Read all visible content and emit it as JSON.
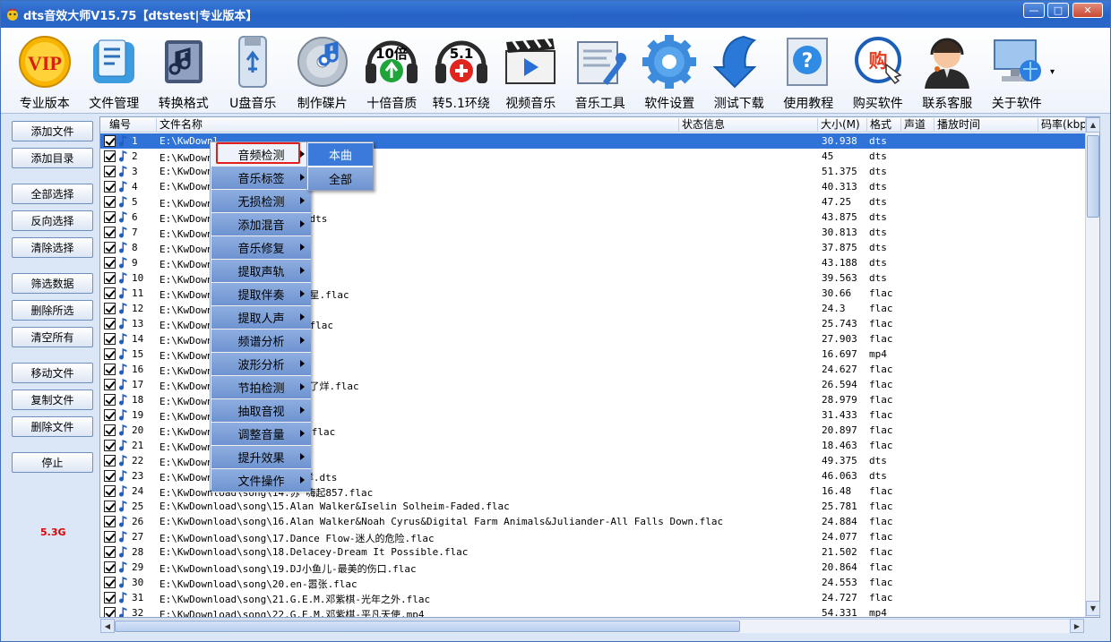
{
  "window": {
    "title": "dts音效大师V15.75【dtstest|专业版本】",
    "controls": {
      "minimize": "—",
      "maximize": "□",
      "close": "✕"
    }
  },
  "toolbar": {
    "items": [
      {
        "label": "专业版本",
        "icon": "vip-icon"
      },
      {
        "label": "文件管理",
        "icon": "file-manage-icon"
      },
      {
        "label": "转换格式",
        "icon": "convert-format-icon"
      },
      {
        "label": "U盘音乐",
        "icon": "usb-music-icon"
      },
      {
        "label": "制作碟片",
        "icon": "disc-icon"
      },
      {
        "label": "十倍音质",
        "icon": "ten-times-quality-icon",
        "badge": "10倍"
      },
      {
        "label": "转5.1环绕",
        "icon": "surround-icon",
        "badge": "5.1"
      },
      {
        "label": "视频音乐",
        "icon": "video-music-icon"
      },
      {
        "label": "音乐工具",
        "icon": "music-tools-icon"
      },
      {
        "label": "软件设置",
        "icon": "settings-gear-icon"
      },
      {
        "label": "测试下载",
        "icon": "download-arrow-icon"
      },
      {
        "label": "使用教程",
        "icon": "help-icon"
      },
      {
        "label": "购买软件",
        "icon": "buy-icon",
        "badge": "购"
      },
      {
        "label": "联系客服",
        "icon": "customer-service-icon"
      },
      {
        "label": "关于软件",
        "icon": "about-computer-icon"
      }
    ],
    "more": "▾"
  },
  "side": {
    "buttons": [
      "添加文件",
      "添加目录",
      "全部选择",
      "反向选择",
      "清除选择",
      "筛选数据",
      "删除所选",
      "清空所有",
      "移动文件",
      "复制文件",
      "删除文件",
      "停止"
    ],
    "disk_size": "5.3G"
  },
  "table": {
    "columns": [
      "编号",
      "文件名称",
      "状态信息",
      "大小(M)",
      "格式",
      "声道",
      "播放时间",
      "码率(kbps"
    ],
    "rows": [
      {
        "n": "1",
        "name": "E:\\KwDownl",
        "size": "30.938",
        "fmt": "dts"
      },
      {
        "n": "2",
        "name": "E:\\KwDownl                        天堂的魔鬼.dts",
        "size": "45",
        "fmt": "dts"
      },
      {
        "n": "3",
        "name": "E:\\KwDownl                        s",
        "size": "51.375",
        "fmt": "dts"
      },
      {
        "n": "4",
        "name": "E:\\KwDownl",
        "size": "40.313",
        "fmt": "dts"
      },
      {
        "n": "5",
        "name": "E:\\KwDownl                        一你若三冬.dts",
        "size": "47.25",
        "fmt": "dts"
      },
      {
        "n": "6",
        "name": "E:\\KwDownl                        一生与你擦肩而过.dts",
        "size": "43.875",
        "fmt": "dts"
      },
      {
        "n": "7",
        "name": "E:\\KwDownl                        一曲相思.dts",
        "size": "30.813",
        "fmt": "dts"
      },
      {
        "n": "8",
        "name": "E:\\KwDownl                        一红色高跟鞋.dts",
        "size": "37.875",
        "fmt": "dts"
      },
      {
        "n": "9",
        "name": "E:\\KwDownl                        一追光者.dts",
        "size": "43.188",
        "fmt": "dts"
      },
      {
        "n": "10",
        "name": "E:\\KwDownl                        一生僻字.dts",
        "size": "39.563",
        "fmt": "dts"
      },
      {
        "n": "11",
        "name": "E:\\KwDownl                        计划-夜空中最亮的星.flac",
        "size": "30.66",
        "fmt": "flac"
      },
      {
        "n": "12",
        "name": "E:\\KwDownl                        你的答案.flac",
        "size": "24.3",
        "fmt": "flac"
      },
      {
        "n": "13",
        "name": "E:\\KwDownl                        一生与你擦肩而过.flac",
        "size": "25.743",
        "fmt": "flac"
      },
      {
        "n": "14",
        "name": "E:\\KwDownl                        你若三冬.flac",
        "size": "27.903",
        "fmt": "flac"
      },
      {
        "n": "15",
        "name": "E:\\KwDownl                        月半弯.mp4",
        "size": "16.697",
        "fmt": "mp4"
      },
      {
        "n": "16",
        "name": "E:\\KwDownl                        生僻字.flac",
        "size": "24.627",
        "fmt": "flac"
      },
      {
        "n": "17",
        "name": "E:\\KwDownl                        星-你的酒馆对我打了烊.flac",
        "size": "26.594",
        "fmt": "flac"
      },
      {
        "n": "18",
        "name": "E:\\KwDownl                        绿色.flac",
        "size": "28.979",
        "fmt": "flac"
      },
      {
        "n": "19",
        "name": "E:\\KwDownl                        寂寞犯的错.flac",
        "size": "31.433",
        "fmt": "flac"
      },
      {
        "n": "20",
        "name": "E:\\KwDownl                        钟听&赵方婧-芒种.flac",
        "size": "20.897",
        "fmt": "flac"
      },
      {
        "n": "21",
        "name": "E:\\KwDownl                        一百花香.flac",
        "size": "18.463",
        "fmt": "flac"
      },
      {
        "n": "22",
        "name": "E:\\KwDownl                        绿色.dts",
        "size": "49.375",
        "fmt": "dts"
      },
      {
        "n": "23",
        "name": "E:\\KwDownl                        你的酒馆对我打了烊.dts",
        "size": "46.063",
        "fmt": "dts"
      },
      {
        "n": "24",
        "name": "E:\\KwDownload\\song\\14.苏  嗨起857.flac",
        "size": "16.48",
        "fmt": "flac"
      },
      {
        "n": "25",
        "name": "E:\\KwDownload\\song\\15.Alan Walker&Iselin Solheim-Faded.flac",
        "size": "25.781",
        "fmt": "flac"
      },
      {
        "n": "26",
        "name": "E:\\KwDownload\\song\\16.Alan Walker&Noah Cyrus&Digital Farm Animals&Juliander-All Falls Down.flac",
        "size": "24.884",
        "fmt": "flac"
      },
      {
        "n": "27",
        "name": "E:\\KwDownload\\song\\17.Dance Flow-迷人的危险.flac",
        "size": "24.077",
        "fmt": "flac"
      },
      {
        "n": "28",
        "name": "E:\\KwDownload\\song\\18.Delacey-Dream It Possible.flac",
        "size": "21.502",
        "fmt": "flac"
      },
      {
        "n": "29",
        "name": "E:\\KwDownload\\song\\19.DJ小鱼儿-最美的伤口.flac",
        "size": "20.864",
        "fmt": "flac"
      },
      {
        "n": "30",
        "name": "E:\\KwDownload\\song\\20.en-嚣张.flac",
        "size": "24.553",
        "fmt": "flac"
      },
      {
        "n": "31",
        "name": "E:\\KwDownload\\song\\21.G.E.M.邓紫棋-光年之外.flac",
        "size": "24.727",
        "fmt": "flac"
      },
      {
        "n": "32",
        "name": "E:\\KwDownload\\song\\22.G.E.M.邓紫棋-平凡天使.mp4",
        "size": "54.331",
        "fmt": "mp4"
      }
    ]
  },
  "context_menu": {
    "items": [
      "音频检测",
      "音乐标签",
      "无损检测",
      "添加混音",
      "音乐修复",
      "提取声轨",
      "提取伴奏",
      "提取人声",
      "频谱分析",
      "波形分析",
      "节拍检测",
      "抽取音视",
      "调整音量",
      "提升效果",
      "文件操作"
    ],
    "active": 0,
    "submenu": [
      "本曲",
      "全部"
    ],
    "submenu_active": 0
  },
  "colors": {
    "selection": "#2f72d8",
    "title_bar": "#2563c6",
    "menu_bg": "#7fa2da",
    "highlight_border": "#e31e1e",
    "disk_text": "#e00000"
  }
}
